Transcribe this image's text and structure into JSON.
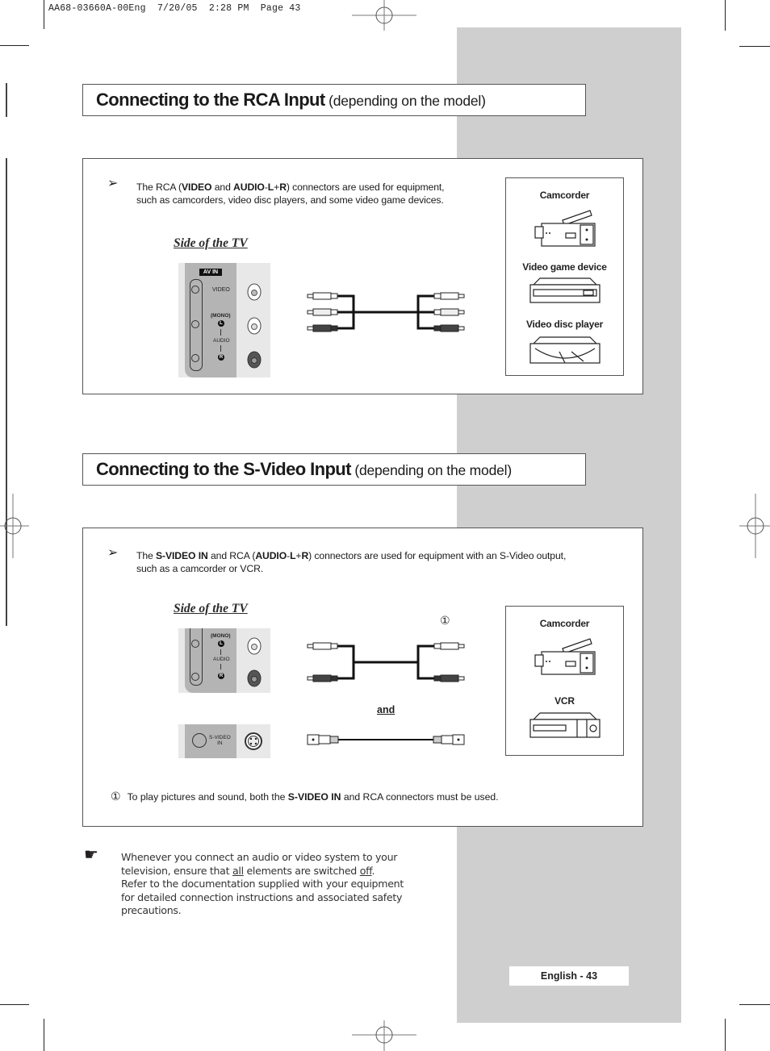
{
  "slug": {
    "doc_id": "AA68-03660A-00Eng",
    "date": "7/20/05",
    "time": "2:28 PM",
    "page_label": "Page 43"
  },
  "section_rca": {
    "title": "Connecting to the RCA Input",
    "subtitle": "(depending on the model)",
    "description": {
      "prefix": "The RCA (",
      "bold_video": "VIDEO",
      "and": " and ",
      "bold_audio": "AUDIO",
      "dash": "-",
      "bold_l": "L",
      "plus": "+",
      "bold_r": "R",
      "suffix": ") connectors are used for equipment,",
      "line2": "such as camcorders, video disc players, and some video game devices."
    },
    "side_label": "Side of the TV",
    "tv_panel": {
      "badge": "AV IN",
      "video": "VIDEO",
      "mono": "(MONO)",
      "l": "L",
      "audio": "AUDIO",
      "r": "R"
    },
    "devices": [
      {
        "label": "Camcorder",
        "icon": "camcorder-icon"
      },
      {
        "label": "Video game device",
        "icon": "video-game-device-icon"
      },
      {
        "label": "Video disc player",
        "icon": "video-disc-player-icon"
      }
    ]
  },
  "section_svideo": {
    "title": "Connecting to the S-Video Input",
    "subtitle": "(depending on the model)",
    "description": {
      "prefix": "The ",
      "bold_svideo": "S-VIDEO IN",
      "mid": " and RCA (",
      "bold_audio": "AUDIO",
      "dash": "-",
      "bold_l": "L",
      "plus": "+",
      "bold_r": "R",
      "suffix": ") connectors are used for equipment with an S-Video output,",
      "line2": "such as a camcorder or VCR."
    },
    "side_label": "Side of the TV",
    "tv_panel": {
      "mono": "(MONO)",
      "l": "L",
      "audio": "AUDIO",
      "r": "R",
      "svideo_line1": "S-VIDEO",
      "svideo_line2": "IN"
    },
    "marker": "①",
    "and_label": "and",
    "devices": [
      {
        "label": "Camcorder",
        "icon": "camcorder-icon"
      },
      {
        "label": "VCR",
        "icon": "vcr-icon"
      }
    ],
    "footnote": {
      "marker": "①",
      "prefix": "To play pictures and sound, both the ",
      "bold": "S-VIDEO IN",
      "suffix": " and RCA connectors must be used."
    }
  },
  "note": {
    "icon": "pointing-hand-icon",
    "line1": "Whenever you connect an audio or video system to your",
    "line2_a": "television, ensure that ",
    "line2_all": "all",
    "line2_b": " elements are switched ",
    "line2_off": "off",
    "line2_c": ".",
    "line3": "Refer to the documentation supplied with your equipment",
    "line4": "for detailed connection instructions and associated safety",
    "line5": "precautions."
  },
  "footer": {
    "page_number": "English - 43"
  },
  "colors": {
    "band_gray": "#cfcfcf",
    "border": "#555555",
    "text": "#231f20"
  }
}
